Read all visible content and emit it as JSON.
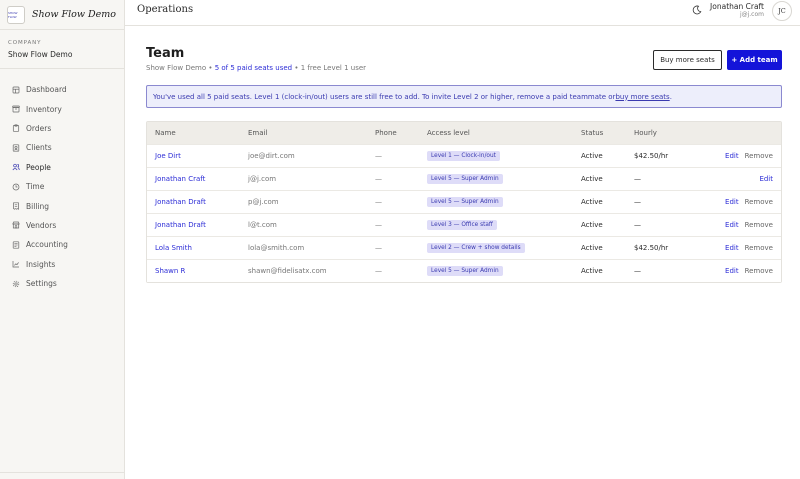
{
  "brand": {
    "logo_text": "SHOW FLOW",
    "name": "Show Flow Demo"
  },
  "company": {
    "label": "COMPANY",
    "name": "Show Flow Demo"
  },
  "nav": [
    {
      "label": "Dashboard",
      "icon": "dashboard-icon"
    },
    {
      "label": "Inventory",
      "icon": "box-icon"
    },
    {
      "label": "Orders",
      "icon": "clipboard-icon"
    },
    {
      "label": "Clients",
      "icon": "contact-card-icon"
    },
    {
      "label": "People",
      "icon": "people-icon",
      "active": true
    },
    {
      "label": "Time",
      "icon": "clock-icon"
    },
    {
      "label": "Billing",
      "icon": "receipt-icon"
    },
    {
      "label": "Vendors",
      "icon": "store-icon"
    },
    {
      "label": "Accounting",
      "icon": "ledger-icon"
    },
    {
      "label": "Insights",
      "icon": "chart-icon"
    },
    {
      "label": "Settings",
      "icon": "gear-icon"
    }
  ],
  "topbar": {
    "title": "Operations",
    "theme_icon": "moon-icon"
  },
  "user": {
    "name": "Jonathan Craft",
    "email": "j@j.com",
    "initials": "JC"
  },
  "page": {
    "title": "Team",
    "subtitle_company": "Show Flow Demo",
    "subtitle_sep1": " • ",
    "subtitle_seats": "5 of 5 paid seats used",
    "subtitle_sep2": " • ",
    "subtitle_free": "1 free Level 1 user",
    "buy_seats_label": "Buy more seats",
    "add_team_label": "+ Add team"
  },
  "notice": {
    "text": "You've used all 5 paid seats. Level 1 (clock-in/out) users are still free to add. To invite Level 2 or higher, remove a paid teammate or ",
    "link": "buy more seats",
    "end": "."
  },
  "table": {
    "headers": {
      "name": "Name",
      "email": "Email",
      "phone": "Phone",
      "access": "Access level",
      "status": "Status",
      "hourly": "Hourly"
    },
    "edit_label": "Edit",
    "remove_label": "Remove",
    "rows": [
      {
        "name": "Joe Dirt",
        "email": "joe@dirt.com",
        "phone": "—",
        "access": "Level 1 — Clock-in/out",
        "status": "Active",
        "hourly": "$42.50/hr",
        "removable": true
      },
      {
        "name": "Jonathan Craft",
        "email": "j@j.com",
        "phone": "—",
        "access": "Level 5 — Super Admin",
        "status": "Active",
        "hourly": "—",
        "removable": false
      },
      {
        "name": "Jonathan Draft",
        "email": "p@j.com",
        "phone": "—",
        "access": "Level 5 — Super Admin",
        "status": "Active",
        "hourly": "—",
        "removable": true
      },
      {
        "name": "Jonathan Draft",
        "email": "l@t.com",
        "phone": "—",
        "access": "Level 3 — Office staff",
        "status": "Active",
        "hourly": "—",
        "removable": true
      },
      {
        "name": "Lola Smith",
        "email": "lola@smith.com",
        "phone": "—",
        "access": "Level 2 — Crew + show details",
        "status": "Active",
        "hourly": "$42.50/hr",
        "removable": true
      },
      {
        "name": "Shawn R",
        "email": "shawn@fidelisatx.com",
        "phone": "—",
        "access": "Level 5 — Super Admin",
        "status": "Active",
        "hourly": "—",
        "removable": true
      }
    ]
  }
}
